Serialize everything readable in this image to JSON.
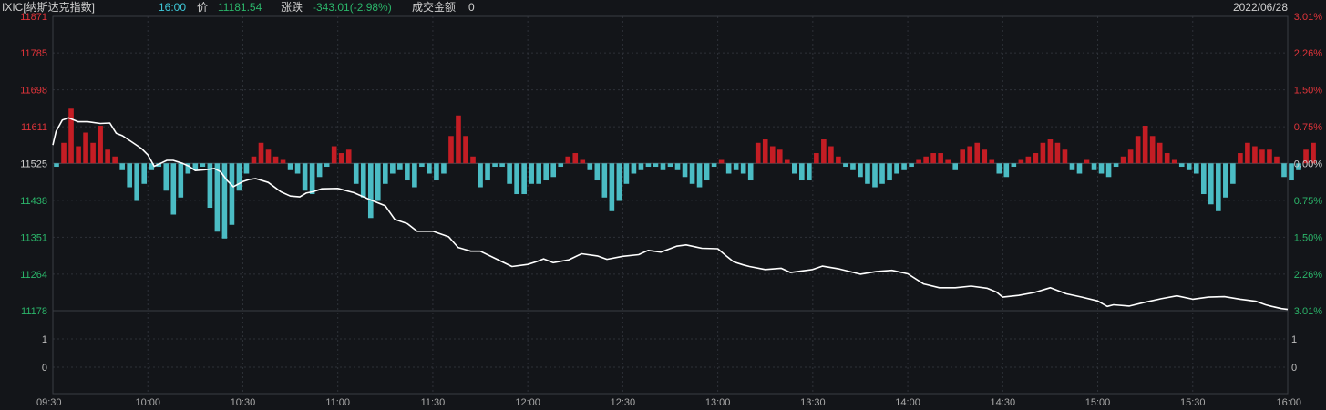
{
  "header": {
    "symbol": "IXIC[纳斯达克指数]",
    "time": "16:00",
    "price_label": "价",
    "price": "11181.54",
    "change_label": "涨跌",
    "change": "-343.01(-2.98%)",
    "turnover_label": "成交金额",
    "turnover": "0",
    "date": "2022/06/28"
  },
  "colors": {
    "background": "#131519",
    "up": "#e0343a",
    "down": "#2bb56a",
    "neutral": "#cfcfcf",
    "cyan": "#3ec8d8",
    "line": "#ffffff",
    "bar_up": "#c41d24",
    "bar_down": "#4bbcc4",
    "grid": "#2e3138"
  },
  "chart_data": {
    "type": "line",
    "title": "",
    "base_price": 11525,
    "price_axis": {
      "ticks": [
        "11871",
        "11785",
        "11698",
        "11611",
        "11525",
        "11438",
        "11351",
        "11264",
        "11178"
      ],
      "values": [
        11871,
        11785,
        11698,
        11611,
        11525,
        11438,
        11351,
        11264,
        11178
      ],
      "pct_ticks": [
        "3.01%",
        "2.26%",
        "1.50%",
        "0.75%",
        "0.00%",
        "0.75%",
        "1.50%",
        "2.26%",
        "3.01%"
      ]
    },
    "volume_axis": {
      "left_ticks": [
        "1",
        "0"
      ],
      "right_ticks": [
        "1",
        "0"
      ]
    },
    "x_ticks": [
      "09:30",
      "10:00",
      "10:30",
      "11:00",
      "11:30",
      "12:00",
      "12:30",
      "13:00",
      "13:30",
      "14:00",
      "14:30",
      "15:00",
      "15:30",
      "16:00"
    ],
    "series": [
      {
        "x": [
          "09:30",
          "09:31",
          "09:33",
          "09:35",
          "09:38",
          "09:41",
          "09:45",
          "09:48",
          "09:50",
          "09:52",
          "09:55",
          "09:58",
          "10:00",
          "10:02",
          "10:04",
          "10:06",
          "10:08",
          "10:11",
          "10:13",
          "10:15",
          "10:18",
          "10:21",
          "10:23",
          "10:25",
          "10:27",
          "10:30",
          "10:32",
          "10:34",
          "10:38",
          "10:42",
          "10:45",
          "10:48",
          "10:50",
          "10:52",
          "10:55",
          "11:00",
          "11:05",
          "11:10",
          "11:15",
          "11:18",
          "11:22",
          "11:25",
          "11:30",
          "11:35",
          "11:38",
          "11:42",
          "11:45",
          "11:50",
          "11:55",
          "12:00",
          "12:03",
          "12:05",
          "12:08",
          "12:13",
          "12:17",
          "12:22",
          "12:25",
          "12:30",
          "12:35",
          "12:38",
          "12:42",
          "12:47",
          "12:50",
          "12:55",
          "13:00",
          "13:03",
          "13:05",
          "13:08",
          "13:10",
          "13:15",
          "13:20",
          "13:23",
          "13:27",
          "13:30",
          "13:33",
          "13:38",
          "13:45",
          "13:50",
          "13:55",
          "14:00",
          "14:05",
          "14:10",
          "14:15",
          "14:20",
          "14:25",
          "14:28",
          "14:30",
          "14:35",
          "14:40",
          "14:45",
          "14:50",
          "14:55",
          "15:00",
          "15:03",
          "15:05",
          "15:10",
          "15:15",
          "15:20",
          "15:25",
          "15:30",
          "15:35",
          "15:40",
          "15:45",
          "15:50",
          "15:53",
          "15:55",
          "15:58",
          "16:00"
        ],
        "y": [
          11568,
          11600,
          11627,
          11632,
          11623,
          11623,
          11619,
          11620,
          11596,
          11590,
          11575,
          11560,
          11545,
          11518,
          11525,
          11532,
          11532,
          11525,
          11518,
          11508,
          11510,
          11513,
          11505,
          11485,
          11470,
          11482,
          11487,
          11489,
          11480,
          11458,
          11448,
          11446,
          11455,
          11458,
          11465,
          11466,
          11456,
          11440,
          11425,
          11393,
          11383,
          11365,
          11365,
          11352,
          11327,
          11318,
          11318,
          11300,
          11282,
          11287,
          11294,
          11300,
          11291,
          11298,
          11312,
          11307,
          11299,
          11306,
          11310,
          11320,
          11316,
          11330,
          11333,
          11325,
          11324,
          11305,
          11293,
          11286,
          11282,
          11275,
          11278,
          11268,
          11272,
          11275,
          11283,
          11277,
          11264,
          11270,
          11273,
          11265,
          11241,
          11232,
          11232,
          11236,
          11231,
          11222,
          11210,
          11214,
          11221,
          11232,
          11218,
          11210,
          11201,
          11188,
          11192,
          11189,
          11198,
          11206,
          11213,
          11205,
          11210,
          11211,
          11205,
          11200,
          11192,
          11188,
          11183,
          11181
        ]
      }
    ],
    "bars": {
      "count": 169,
      "values": [
        -0.05,
        0.3,
        0.8,
        0.25,
        0.45,
        0.3,
        0.55,
        0.2,
        0.1,
        -0.1,
        -0.35,
        -0.55,
        -0.3,
        -0.1,
        -0.05,
        -0.4,
        -0.75,
        -0.5,
        -0.15,
        -0.1,
        -0.05,
        -0.65,
        -1.0,
        -1.1,
        -0.9,
        -0.4,
        -0.15,
        0.1,
        0.3,
        0.2,
        0.1,
        0.05,
        -0.1,
        -0.15,
        -0.4,
        -0.45,
        -0.2,
        -0.05,
        0.25,
        0.15,
        0.2,
        -0.3,
        -0.5,
        -0.8,
        -0.55,
        -0.3,
        -0.15,
        -0.1,
        -0.25,
        -0.35,
        -0.05,
        -0.15,
        -0.25,
        -0.15,
        0.4,
        0.7,
        0.4,
        0.1,
        -0.35,
        -0.25,
        -0.05,
        -0.05,
        -0.3,
        -0.45,
        -0.45,
        -0.3,
        -0.3,
        -0.25,
        -0.2,
        -0.05,
        0.1,
        0.15,
        0.05,
        -0.1,
        -0.25,
        -0.5,
        -0.7,
        -0.55,
        -0.3,
        -0.15,
        -0.1,
        -0.05,
        -0.05,
        -0.1,
        -0.05,
        -0.1,
        -0.2,
        -0.3,
        -0.35,
        -0.25,
        -0.05,
        0.05,
        -0.15,
        -0.1,
        -0.15,
        -0.25,
        0.3,
        0.35,
        0.25,
        0.2,
        0.05,
        -0.15,
        -0.25,
        -0.25,
        0.15,
        0.35,
        0.25,
        0.1,
        -0.05,
        -0.1,
        -0.2,
        -0.3,
        -0.35,
        -0.3,
        -0.25,
        -0.15,
        -0.1,
        -0.05,
        0.05,
        0.1,
        0.15,
        0.15,
        0.05,
        -0.1,
        0.2,
        0.25,
        0.3,
        0.2,
        0.05,
        -0.15,
        -0.2,
        -0.05,
        0.05,
        0.1,
        0.15,
        0.3,
        0.35,
        0.3,
        0.2,
        -0.1,
        -0.15,
        0.05,
        -0.1,
        -0.15,
        -0.2,
        -0.05,
        0.1,
        0.2,
        0.4,
        0.55,
        0.4,
        0.3,
        0.15,
        0.05,
        -0.05,
        -0.1,
        -0.15,
        -0.45,
        -0.6,
        -0.7,
        -0.5,
        -0.3,
        0.15,
        0.3,
        0.25,
        0.2,
        0.2,
        0.1,
        -0.2,
        -0.25,
        -0.1,
        0.2,
        0.3
      ]
    },
    "grid": true
  }
}
